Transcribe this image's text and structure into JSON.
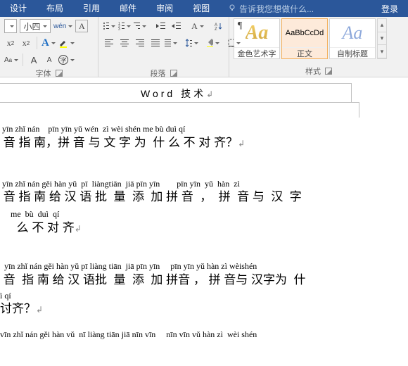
{
  "tabs": {
    "design": "设计",
    "layout": "布局",
    "references": "引用",
    "mailings": "邮件",
    "review": "审阅",
    "view": "视图"
  },
  "tellme": "告诉我您想做什么...",
  "login": "登录",
  "font": {
    "size": "小四",
    "wen": "wén",
    "A": "A",
    "grow": "A",
    "shrink": "A",
    "ruby": "字",
    "groupLabel": "字体"
  },
  "paragraph": {
    "groupLabel": "段落"
  },
  "styles": {
    "groupLabel": "样式",
    "tiles": [
      {
        "name": "金色艺术字",
        "previewClass": "gold-text",
        "preview": "Aa"
      },
      {
        "name": "正文",
        "previewClass": "",
        "preview": "AaBbCcDd"
      },
      {
        "name": "自制标题",
        "previewClass": "custom-title",
        "preview": "Aa"
      }
    ]
  },
  "doc": {
    "title": "Word 技术",
    "p1": {
      "pinyin": " yīn zhǐ nán    pīn yīn yǔ wén  zì wèi shén me bù duì qí",
      "hanzi": " 音 指 南，拼 音 与 文 字 为  什 么 不 对 齐？"
    },
    "p2": {
      "pinyin1": " yīn zhǐ nán gěi hàn yǔ  pī  liàngtiān  jiā pīn yīn        pīn yīn  yǔ  hàn  zì",
      "hanzi1": " 音 指 南 给 汉 语 批  量  添  加 拼 音  ，  拼  音 与  汉  字",
      "pinyin2": "     me  bù  duì  qí",
      "hanzi2": "     么 不 对 齐"
    },
    "p3": {
      "pinyin1": "  yīn zhǐ nán gěi hàn yǔ pī liàng tiān  jiā pīn yīn     pīn yīn yǔ hàn zì wèishén",
      "hanzi1": " 音  指 南 给 汉 语批  量  添  加 拼音 ， 拼 音与 汉字为  什",
      "pinyin2": "ì qí",
      "hanzi2": "讨齐？"
    },
    "p4pinyin": "vīn zhǐ nán gěi hàn vǔ  nī liàng tiān jiā nīn vīn     nīn vīn vǔ hàn zì  wèi shén"
  }
}
